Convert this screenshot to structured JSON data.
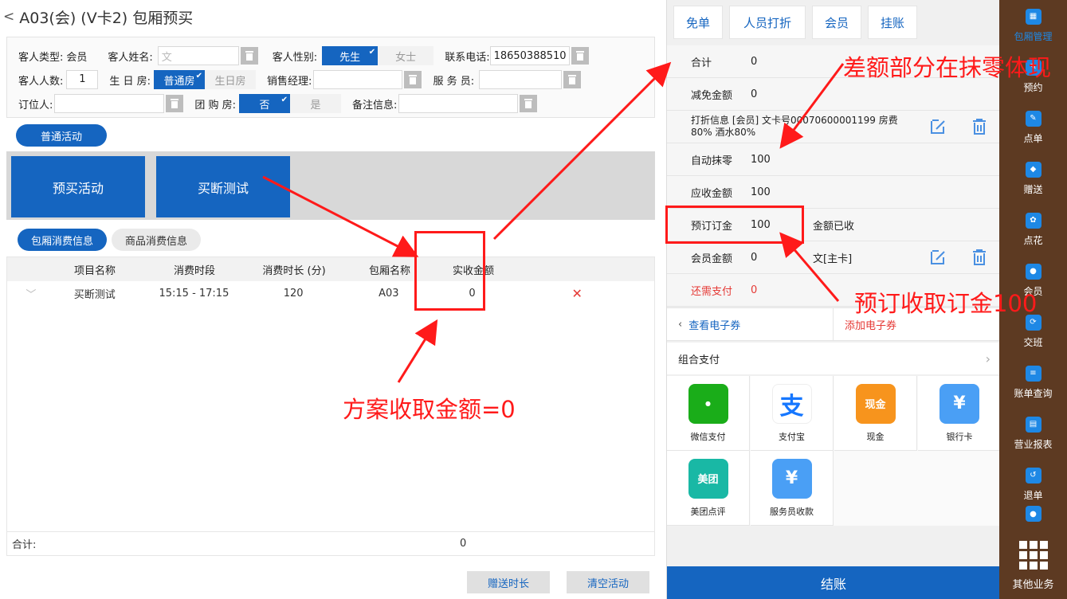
{
  "header": {
    "back": "<",
    "title": "A03(会) (V卡2) 包厢预买"
  },
  "form": {
    "guest_type_label": "客人类型:",
    "guest_type_value": "会员",
    "guest_name_label": "客人姓名:",
    "guest_name_placeholder": "文",
    "gender_label": "客人性别:",
    "gender_male": "先生",
    "gender_female": "女士",
    "phone_label": "联系电话:",
    "phone_value": "18650388510",
    "count_label": "客人人数:",
    "count_value": "1",
    "birthday_label": "生 日 房:",
    "birthday_normal": "普通房",
    "birthday_bday": "生日房",
    "sales_label": "销售经理:",
    "waiter_label": "服 务 员:",
    "booker_label": "订位人:",
    "group_label": "团 购 房:",
    "group_no": "否",
    "group_yes": "是",
    "remark_label": "备注信息:"
  },
  "activity_pill": "普通活动",
  "activities": [
    "预买活动",
    "买断测试"
  ],
  "info_tabs": [
    "包厢消费信息",
    "商品消费信息"
  ],
  "table": {
    "headers": [
      "项目名称",
      "消费时段",
      "消费时长 (分)",
      "包厢名称",
      "实收金额"
    ],
    "rows": [
      {
        "name": "买断测试",
        "period": "15:15 - 17:15",
        "duration": "120",
        "room": "A03",
        "amount": "0",
        "delete": "✕"
      }
    ],
    "total_label": "合计:",
    "total_value": "0"
  },
  "bottom_buttons": [
    "赠送时长",
    "清空活动"
  ],
  "top_buttons": [
    "免单",
    "人员打折",
    "会员",
    "挂账"
  ],
  "summary": {
    "total_label": "合计",
    "total_value": "0",
    "reduce_label": "减免金额",
    "reduce_value": "0",
    "discount_text": "打折信息 [会员] 文卡号00070600001199 房费80% 酒水80%",
    "rounding_label": "自动抹零",
    "rounding_value": "100",
    "receivable_label": "应收金额",
    "receivable_value": "100",
    "deposit_label": "预订订金",
    "deposit_value": "100",
    "deposit_note": "金额已收",
    "member_label": "会员金额",
    "member_value": "0",
    "member_note": "文[主卡]",
    "due_label": "还需支付",
    "due_value": "0"
  },
  "coupon": {
    "view": "查看电子券",
    "add": "添加电子券"
  },
  "combo_pay": "组合支付",
  "payments": [
    {
      "label": "微信支付",
      "icon": "wechat-pay-icon",
      "color": "#1aad19",
      "glyph": "微信支付"
    },
    {
      "label": "支付宝",
      "icon": "alipay-icon",
      "color": "#ffffff",
      "glyph": "支"
    },
    {
      "label": "现金",
      "icon": "cash-icon",
      "color": "#f7941d",
      "glyph": "现金"
    },
    {
      "label": "银行卡",
      "icon": "bank-card-icon",
      "color": "#4a9ff5",
      "glyph": "¥"
    },
    {
      "label": "美团点评",
      "icon": "meituan-icon",
      "color": "#19b8a5",
      "glyph": "美团"
    },
    {
      "label": "服务员收款",
      "icon": "waiter-collect-icon",
      "color": "#4a9ff5",
      "glyph": "¥"
    }
  ],
  "checkout": "结账",
  "sidebar": {
    "items": [
      {
        "label": "包厢管理",
        "icon": "room-manage-icon"
      },
      {
        "label": "预约",
        "icon": "reserve-icon"
      },
      {
        "label": "点单",
        "icon": "order-icon"
      },
      {
        "label": "赠送",
        "icon": "gift-icon"
      },
      {
        "label": "点花",
        "icon": "flower-icon"
      },
      {
        "label": "会员",
        "icon": "member-icon"
      },
      {
        "label": "交班",
        "icon": "handover-icon"
      },
      {
        "label": "账单查询",
        "icon": "bill-query-icon"
      },
      {
        "label": "营业报表",
        "icon": "report-icon"
      },
      {
        "label": "退单",
        "icon": "refund-icon"
      }
    ],
    "other": "其他业务"
  },
  "annotations": {
    "diff_note": "差额部分在抹零体现",
    "deposit_note": "预订收取订金100",
    "plan_note": "方案收取金额=0"
  },
  "colors": {
    "primary": "#1565c0",
    "annotation": "#ff1a1a",
    "sidebar": "#5d3a22",
    "danger": "#e53935"
  }
}
